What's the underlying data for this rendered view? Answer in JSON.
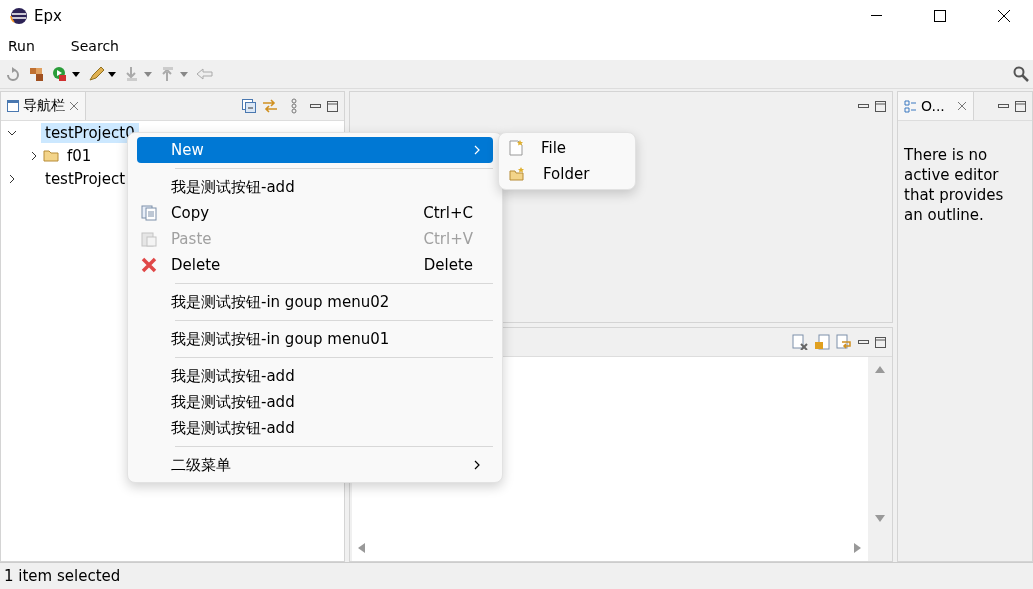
{
  "window": {
    "title": "Epx"
  },
  "menu_bar": [
    "Run",
    "Search"
  ],
  "navigator": {
    "title": "导航栏",
    "tree": [
      {
        "label": "testProject0",
        "expanded": true,
        "selected": true,
        "kind": "project",
        "children": [
          {
            "label": "f01",
            "expanded": false,
            "selected": false,
            "kind": "folder"
          }
        ]
      },
      {
        "label": "testProject",
        "expanded": false,
        "selected": false,
        "kind": "project"
      }
    ]
  },
  "context_menu": [
    {
      "kind": "submenu",
      "label": "New",
      "selected": true
    },
    {
      "kind": "separator"
    },
    {
      "kind": "command",
      "label": "我是测试按钮-add",
      "disabled": false
    },
    {
      "kind": "copy",
      "label": "Copy",
      "shortcut": "Ctrl+C",
      "disabled": false
    },
    {
      "kind": "paste",
      "label": "Paste",
      "shortcut": "Ctrl+V",
      "disabled": true
    },
    {
      "kind": "delete",
      "label": "Delete",
      "shortcut": "Delete",
      "disabled": false
    },
    {
      "kind": "separator"
    },
    {
      "kind": "command",
      "label": "我是测试按钮-in goup menu02",
      "disabled": false
    },
    {
      "kind": "separator"
    },
    {
      "kind": "command",
      "label": "我是测试按钮-in goup menu01",
      "disabled": false
    },
    {
      "kind": "separator"
    },
    {
      "kind": "command",
      "label": "我是测试按钮-add",
      "disabled": false
    },
    {
      "kind": "command",
      "label": "我是测试按钮-add",
      "disabled": false
    },
    {
      "kind": "command",
      "label": "我是测试按钮-add",
      "disabled": false
    },
    {
      "kind": "separator"
    },
    {
      "kind": "submenu",
      "label": "二级菜单",
      "selected": false
    }
  ],
  "submenu": [
    {
      "kind": "file",
      "label": "File"
    },
    {
      "kind": "folder",
      "label": "Folder"
    }
  ],
  "outline": {
    "title": "O...",
    "message": "There is no active editor that provides an outline."
  },
  "status_bar": "1 item selected"
}
